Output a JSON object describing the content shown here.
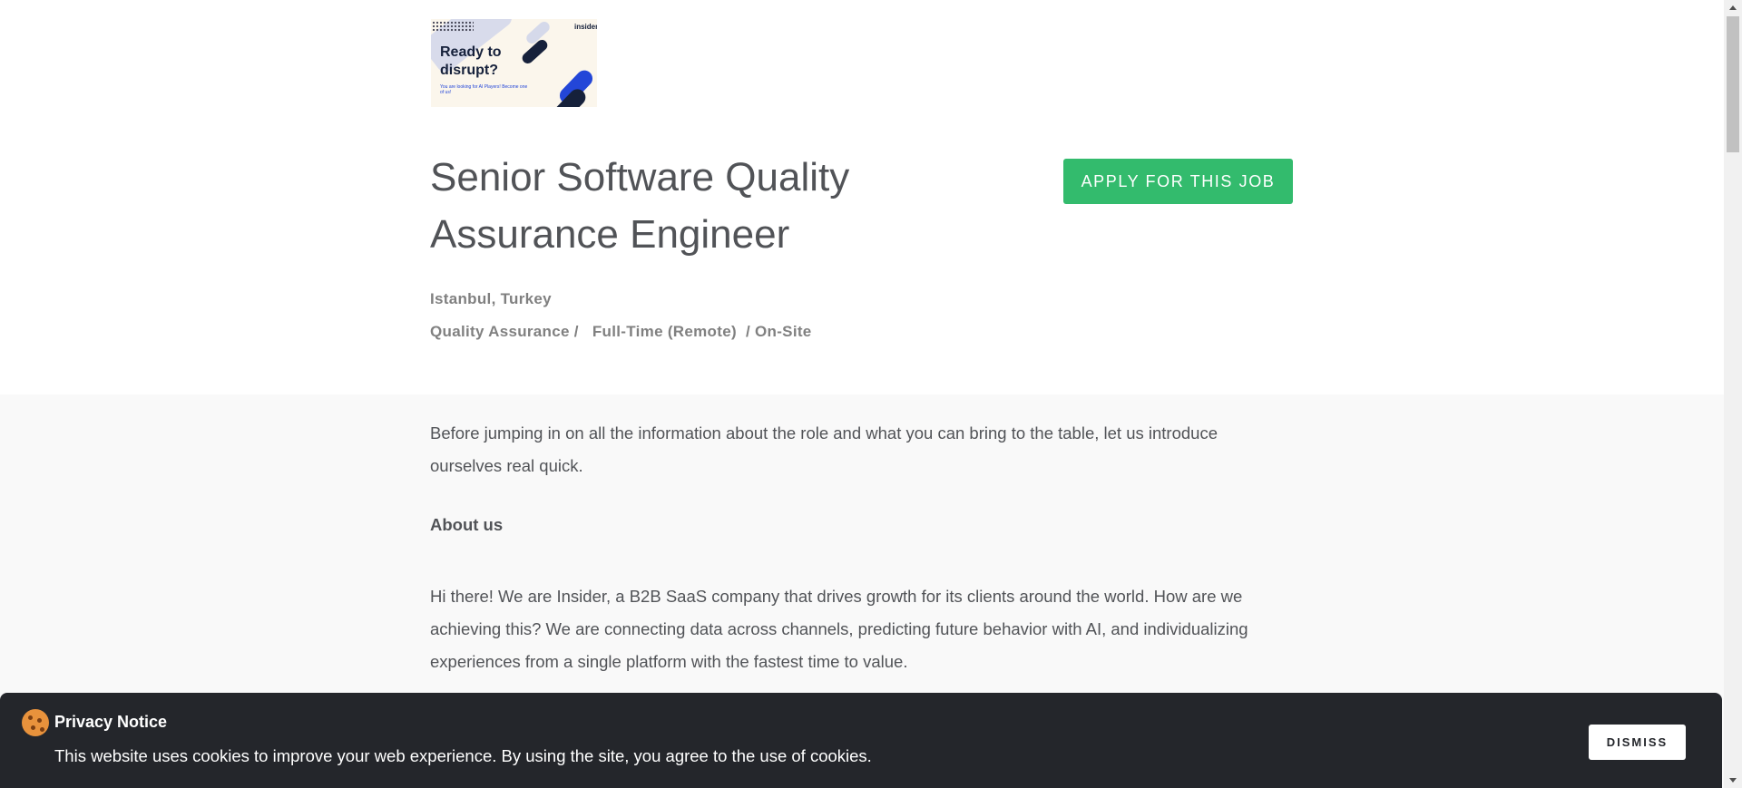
{
  "logo": {
    "brand": "insider",
    "headline": "Ready to disrupt?",
    "subline": "You are looking for AI Players! Become one of us!"
  },
  "job": {
    "title": "Senior Software Quality Assurance Engineer",
    "apply_label": "APPLY FOR THIS JOB",
    "location": "Istanbul, Turkey",
    "categories": [
      "Quality Assurance /",
      "Full-Time (Remote)",
      "/ On-Site"
    ]
  },
  "content": {
    "intro": "Before jumping in on all the information about the role and what you can bring to the table, let us introduce ourselves real quick.",
    "about_heading": "About us",
    "about_text": "Hi there! We are Insider, a B2B SaaS company that drives growth for its clients around the world. How are we achieving this? We are connecting data across channels, predicting future behavior with AI, and individualizing experiences from a single platform with the fastest time to value."
  },
  "cookie": {
    "title": "Privacy Notice",
    "text": "This website uses cookies to improve your web experience. By using the site, you agree to the use of cookies.",
    "dismiss_label": "DISMISS"
  },
  "colors": {
    "apply_button": "#33bb6d",
    "cookie_banner": "#24262b",
    "content_background": "#f9f9f9"
  },
  "icons": [
    "cookie-icon",
    "scroll-up-arrow-icon",
    "scroll-down-arrow-icon"
  ]
}
